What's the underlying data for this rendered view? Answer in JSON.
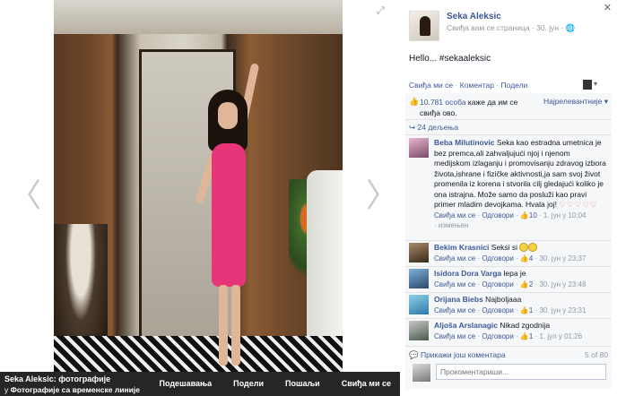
{
  "viewer": {
    "prev_glyph": "〈",
    "next_glyph": "〉",
    "expand_icon": "expand-icon",
    "caption_title": "Seka Aleksic: фотографије",
    "caption_prefix": "у",
    "caption_album": "Фотографије са временске линије",
    "actions": [
      "Подешавања",
      "Подели",
      "Пошаљи",
      "Свиђа ми се"
    ]
  },
  "post": {
    "close": "✕",
    "author": "Seka Aleksic",
    "meta": "Свиђа вам се страница · 30. јун · 🌐",
    "text": "Hello... #sekaaleksic",
    "actions": {
      "like": "Свиђа ми се",
      "comment": "Коментар",
      "share": "Подели",
      "dot": "·"
    },
    "likes": {
      "count_link": "10.781 особа",
      "suffix": " каже да им се свиђа ово.",
      "sort": "Најрелевантније ▾"
    },
    "shares": "24 дељења",
    "comments": [
      {
        "name": "Beba Milutinovic",
        "text": " Seka kao estradna umetnica je bez premca,ali zahvaljujući njoj i njenom medijskom izlaganju i promovisanju zdravog izbora života,ishrane i fizičke aktivnosti,ja sam svoj život promenila iz korena i stvorila cilj gledajući koliko je ona istrajna. Može samo da posluži kao pravi primer mladim devojkama. Hvala joj!",
        "hearts": "♡♡♡♡♡",
        "like": "Свиђа ми се",
        "reply": "Одговори",
        "likes": "10",
        "time": "1. јун у 10:04",
        "edited": "· измењен"
      },
      {
        "name": "Bekim Krasnici",
        "text": " Seksi si",
        "like": "Свиђа ми се",
        "reply": "Одговори",
        "likes": "4",
        "time": "30. јун у 23:37"
      },
      {
        "name": "Isidora Dora Varga",
        "text": " lepa je",
        "like": "Свиђа ми се",
        "reply": "Одговори",
        "likes": "2",
        "time": "30. јун у 23:48"
      },
      {
        "name": "Orijana Biebs",
        "text": " Najboljaaa",
        "like": "Свиђа ми се",
        "reply": "Одговори",
        "likes": "1",
        "time": "30. јун у 23:31"
      },
      {
        "name": "Aljoša Arslanagic",
        "text": " Nikad zgodnija",
        "like": "Свиђа ми се",
        "reply": "Одговори",
        "likes": "1",
        "time": "1. јул у 01:26"
      }
    ],
    "more_comments": "Прикажи још коментара",
    "counter": "5 of 80",
    "reply_placeholder": "Прокоментариши..."
  }
}
